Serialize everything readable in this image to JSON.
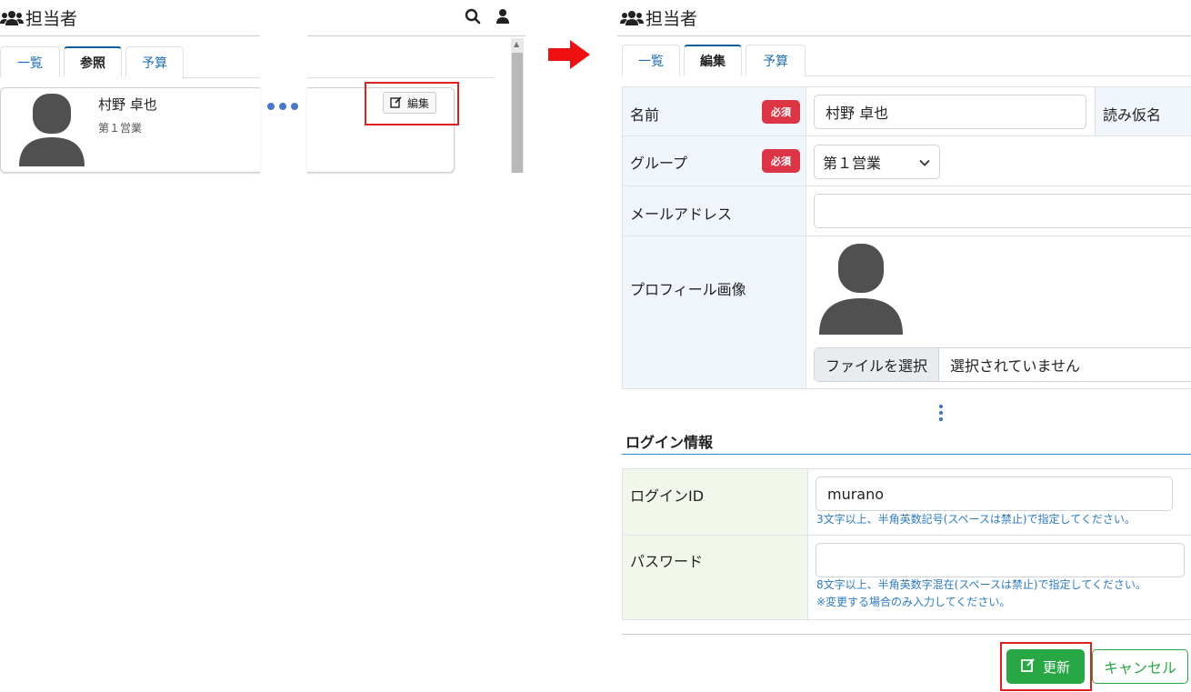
{
  "left": {
    "title": "担当者",
    "tabs": [
      {
        "label": "一覧",
        "active": false
      },
      {
        "label": "参照",
        "active": true
      },
      {
        "label": "予算",
        "active": false
      }
    ],
    "card": {
      "name": "村野 卓也",
      "group": "第１営業"
    },
    "edit_label": "編集"
  },
  "right": {
    "title": "担当者",
    "tabs": [
      {
        "label": "一覧",
        "active": false
      },
      {
        "label": "編集",
        "active": true
      },
      {
        "label": "予算",
        "active": false
      }
    ],
    "form": {
      "name_label": "名前",
      "required_label": "必須",
      "name_value": "村野 卓也",
      "kana_label": "読み仮名",
      "group_label": "グループ",
      "group_value": "第１営業",
      "email_label": "メールアドレス",
      "email_value": "",
      "image_label": "プロフィール画像",
      "file_button": "ファイルを選択",
      "file_status": "選択されていません"
    },
    "login": {
      "section_title": "ログイン情報",
      "id_label": "ログインID",
      "id_value": "murano",
      "id_help": "3文字以上、半角英数記号(スペースは禁止)で指定してください。",
      "password_label": "パスワード",
      "password_value": "",
      "password_help1": "8文字以上、半角英数字混在(スペースは禁止)で指定してください。",
      "password_help2": "※変更する場合のみ入力してください。"
    },
    "buttons": {
      "update": "更新",
      "cancel": "キャンセル"
    }
  },
  "colors": {
    "accent_red": "#e02020",
    "required_badge": "#dc3545",
    "update_green": "#28a745",
    "link_blue": "#1f6fb5"
  },
  "icons": {
    "users": "users-icon",
    "search": "search-icon",
    "user": "user-icon",
    "edit": "edit-icon",
    "arrow": "right-arrow-icon",
    "more": "more-dots-icon",
    "avatar": "avatar-placeholder"
  }
}
